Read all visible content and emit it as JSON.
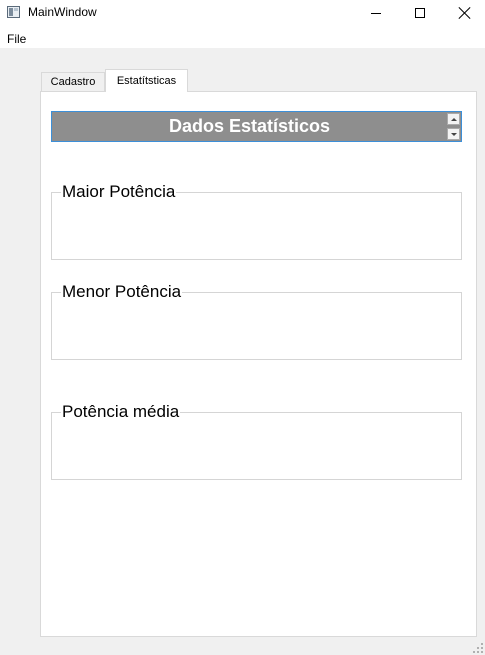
{
  "window": {
    "title": "MainWindow",
    "icon": "app-window-icon",
    "controls": {
      "minimize": "minimize",
      "maximize": "maximize",
      "close": "close"
    }
  },
  "menubar": {
    "items": [
      {
        "label": "File"
      }
    ]
  },
  "tabs": [
    {
      "label": "Cadastro",
      "selected": false
    },
    {
      "label": "Estatítsticas",
      "selected": true
    }
  ],
  "stats": {
    "header": "Dados Estatísticos",
    "groups": [
      {
        "title": "Maior Potência"
      },
      {
        "title": "Menor Potência"
      },
      {
        "title": "Potência média"
      }
    ]
  }
}
